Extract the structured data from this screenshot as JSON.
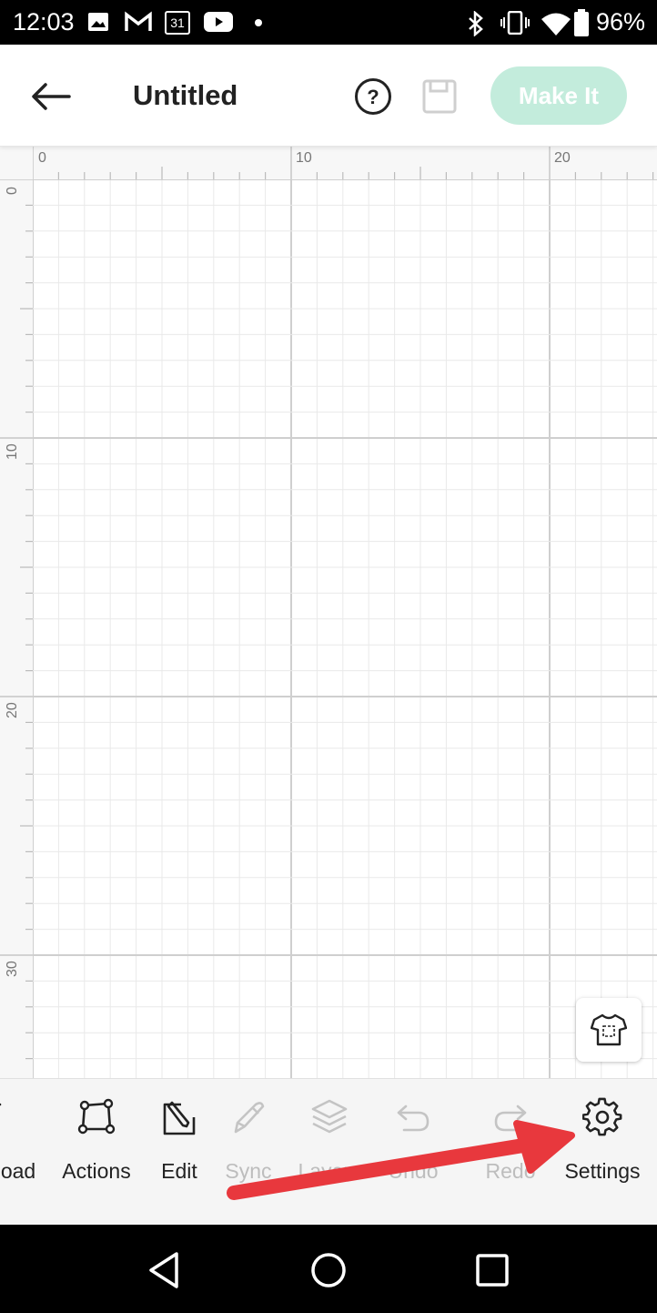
{
  "status_bar": {
    "time": "12:03",
    "battery": "96%",
    "icons": [
      "image-icon",
      "gmail-icon",
      "calendar-icon",
      "youtube-icon",
      "dot-icon",
      "bluetooth-icon",
      "vibrate-icon",
      "wifi-icon",
      "battery-icon"
    ],
    "calendar_day": "31"
  },
  "app_bar": {
    "title": "Untitled",
    "make_it_label": "Make It",
    "accent_color": "#c3ecdc"
  },
  "rulers": {
    "top_labels": [
      "0",
      "10",
      "20"
    ],
    "left_labels": [
      "0",
      "10",
      "20",
      "30"
    ]
  },
  "toolbar": {
    "items": [
      {
        "label": "oad",
        "icon": "upload-icon",
        "enabled": true
      },
      {
        "label": "Actions",
        "icon": "actions-icon",
        "enabled": true
      },
      {
        "label": "Edit",
        "icon": "edit-icon",
        "enabled": true
      },
      {
        "label": "Sync",
        "icon": "sync-icon",
        "enabled": false
      },
      {
        "label": "Layers",
        "icon": "layers-icon",
        "enabled": false
      },
      {
        "label": "Undo",
        "icon": "undo-icon",
        "enabled": false
      },
      {
        "label": "Redo",
        "icon": "redo-icon",
        "enabled": false
      },
      {
        "label": "Settings",
        "icon": "settings-icon",
        "enabled": true
      }
    ]
  },
  "annotation": {
    "color": "#e8383d",
    "target": "Settings"
  }
}
